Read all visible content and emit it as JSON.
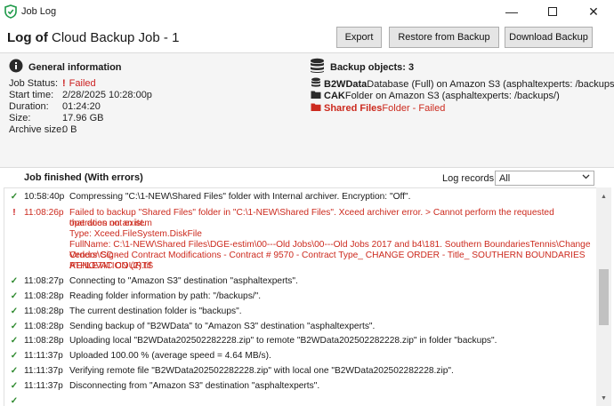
{
  "window": {
    "title": "Job Log",
    "minimize": "—",
    "close": "✕"
  },
  "header": {
    "title_prefix": "Log of",
    "title_job": "Cloud Backup Job - 1",
    "buttons": {
      "export": "Export",
      "restore": "Restore from Backup",
      "download": "Download Backup"
    }
  },
  "general": {
    "heading": "General information",
    "fields": [
      {
        "label": "Job Status:",
        "value": "Failed",
        "status_icon": "!"
      },
      {
        "label": "Start time:",
        "value": "2/28/2025 10:28:00p"
      },
      {
        "label": "Duration:",
        "value": "01:24:20"
      },
      {
        "label": "Size:",
        "value": "17.96 GB"
      },
      {
        "label": "Archive size:",
        "value": "0 B"
      }
    ]
  },
  "backup_objects": {
    "heading": "Backup objects: 3",
    "items": [
      {
        "name": "B2WData",
        "rest": " Database (Full) on Amazon S3 (asphaltexperts: /backups/)",
        "icon": "database-icon"
      },
      {
        "name": "CAK",
        "rest": " Folder on Amazon S3 (asphaltexperts: /backups/)",
        "icon": "folder-icon"
      },
      {
        "name": "Shared Files",
        "rest": " Folder - Failed",
        "icon": "folder-icon"
      }
    ]
  },
  "log": {
    "title": "Job finished (With errors)",
    "records_label": "Log records",
    "filter_value": "All",
    "rows": [
      {
        "status": "ok",
        "time": "10:58:40p",
        "lines": [
          "Compressing \"C:\\1-NEW\\Shared Files\" folder with Internal archiver. Encryption: \"Off\"."
        ]
      },
      {
        "status": "error",
        "time": "11:08:26p",
        "lines": [
          "Failed to backup \"Shared Files\" folder in \"C:\\1-NEW\\Shared Files\". Xceed archiver error. > Cannot perform the requested operation on an item",
          "that does not exist.",
          "Type: Xceed.FileSystem.DiskFile",
          "FullName: C:\\1-NEW\\Shared Files\\DGE-estim\\00---Old Jobs\\00---Old Jobs 2017 and b4\\181. Southern BoundariesTennis\\Change Orders\\CC -",
          "Vendor Signed Contract Modifications - Contract # 9570 - Contract Type_ CHANGE ORDER - Title_ SOUTHERN BOUNDARIES ATHLETIC COURTS",
          "RENOVATION (2).tif"
        ]
      },
      {
        "status": "ok",
        "time": "11:08:27p",
        "lines": [
          "Connecting to \"Amazon S3\" destination \"asphaltexperts\"."
        ]
      },
      {
        "status": "ok",
        "time": "11:08:28p",
        "lines": [
          "Reading folder information by path: \"/backups/\"."
        ]
      },
      {
        "status": "ok",
        "time": "11:08:28p",
        "lines": [
          "The current destination folder is \"backups\"."
        ]
      },
      {
        "status": "ok",
        "time": "11:08:28p",
        "lines": [
          "Sending backup of \"B2WData\" to \"Amazon S3\" destination \"asphaltexperts\"."
        ]
      },
      {
        "status": "ok",
        "time": "11:08:28p",
        "lines": [
          "Uploading local \"B2WData202502282228.zip\" to remote \"B2WData202502282228.zip\" in folder \"backups\"."
        ]
      },
      {
        "status": "ok",
        "time": "11:11:37p",
        "lines": [
          "Uploaded 100.00 % (average speed = 4.64 MB/s)."
        ]
      },
      {
        "status": "ok",
        "time": "11:11:37p",
        "lines": [
          "Verifying remote file \"B2WData202502282228.zip\" with local one \"B2WData202502282228.zip\"."
        ]
      },
      {
        "status": "ok",
        "time": "11:11:37p",
        "lines": [
          "Disconnecting from \"Amazon S3\" destination \"asphaltexperts\"."
        ]
      }
    ]
  },
  "colors": {
    "error_red": "#cc1f1f",
    "ok_green": "#2f8a2f",
    "panel_gray": "#f5f5f5"
  }
}
